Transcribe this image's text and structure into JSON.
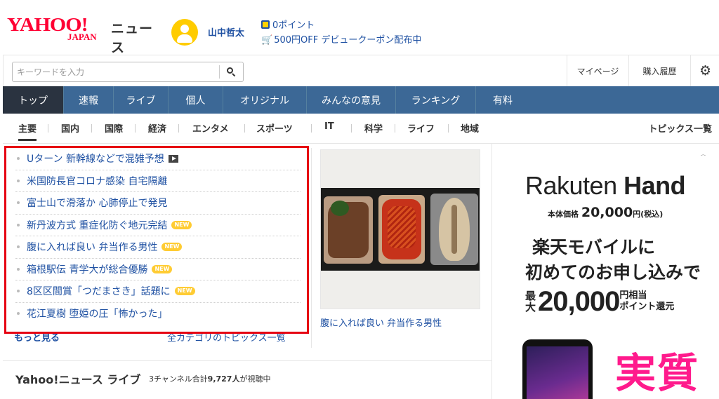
{
  "header": {
    "logo_main": "YAHOO!",
    "logo_sub": "JAPAN",
    "logo_service": "ニュース",
    "username": "山中哲太",
    "points": "0ポイント",
    "coupon": "500円OFF デビュークーポン配布中"
  },
  "search": {
    "placeholder": "キーワードを入力",
    "value": ""
  },
  "utility": {
    "mypage": "マイページ",
    "history": "購入履歴",
    "settings_icon": "gear-icon"
  },
  "main_nav": {
    "tabs": [
      {
        "label": "トップ",
        "active": true
      },
      {
        "label": "速報"
      },
      {
        "label": "ライブ"
      },
      {
        "label": "個人"
      },
      {
        "label": "オリジナル"
      },
      {
        "label": "みんなの意見"
      },
      {
        "label": "ランキング"
      },
      {
        "label": "有料"
      }
    ]
  },
  "sub_nav": {
    "items": [
      {
        "label": "主要",
        "active": true
      },
      {
        "label": "国内"
      },
      {
        "label": "国際"
      },
      {
        "label": "経済"
      },
      {
        "label": "エンタメ"
      },
      {
        "label": "スポーツ"
      },
      {
        "label": "IT"
      },
      {
        "label": "科学"
      },
      {
        "label": "ライフ"
      },
      {
        "label": "地域"
      }
    ],
    "topics_all": "トピックス一覧"
  },
  "topics": {
    "items": [
      {
        "title": "Uターン 新幹線などで混雑予想",
        "badge": "video"
      },
      {
        "title": "米国防長官コロナ感染 自宅隔離",
        "badge": ""
      },
      {
        "title": "富士山で滑落か 心肺停止で発見",
        "badge": ""
      },
      {
        "title": "新丹波方式 重症化防ぐ地元完結",
        "badge": "NEW"
      },
      {
        "title": "腹に入れば良い 弁当作る男性",
        "badge": "NEW"
      },
      {
        "title": "箱根駅伝 青学大が総合優勝",
        "badge": "NEW"
      },
      {
        "title": "8区区間賞「つだまさき」話題に",
        "badge": "NEW"
      },
      {
        "title": "花江夏樹 堕姫の圧「怖かった」",
        "badge": ""
      }
    ],
    "new_label": "NEW",
    "more_link": "もっと見る",
    "all_topics_link": "全カテゴリのトピックス一覧"
  },
  "feature": {
    "caption": "腹に入れば良い 弁当作る男性"
  },
  "ad": {
    "brand_light": "Rakuten ",
    "brand_bold": "Hand",
    "price_label": "本体価格 ",
    "price_value": "20,000",
    "price_suffix": "円(税込)",
    "line1": "楽天モバイルに",
    "line2": "初めてのお申し込みで",
    "max_label": "最大",
    "amount": "20,000",
    "amount_suffix": "円相当\nポイント還元",
    "cta": "実質",
    "icons": "ⓘ ✕"
  },
  "live": {
    "title": "Yahoo!ニュース ライブ",
    "desc_prefix": "3チャンネル合計",
    "desc_count": "9,727人",
    "desc_suffix": "が視聴中"
  },
  "colors": {
    "brand_red": "#ff0033",
    "nav_blue": "#3c6896",
    "nav_active": "#2a3340",
    "link_blue": "#1e50a2",
    "new_badge": "#ffcc33",
    "highlight_red": "#e60012",
    "ad_pink": "#ff1a8c"
  }
}
